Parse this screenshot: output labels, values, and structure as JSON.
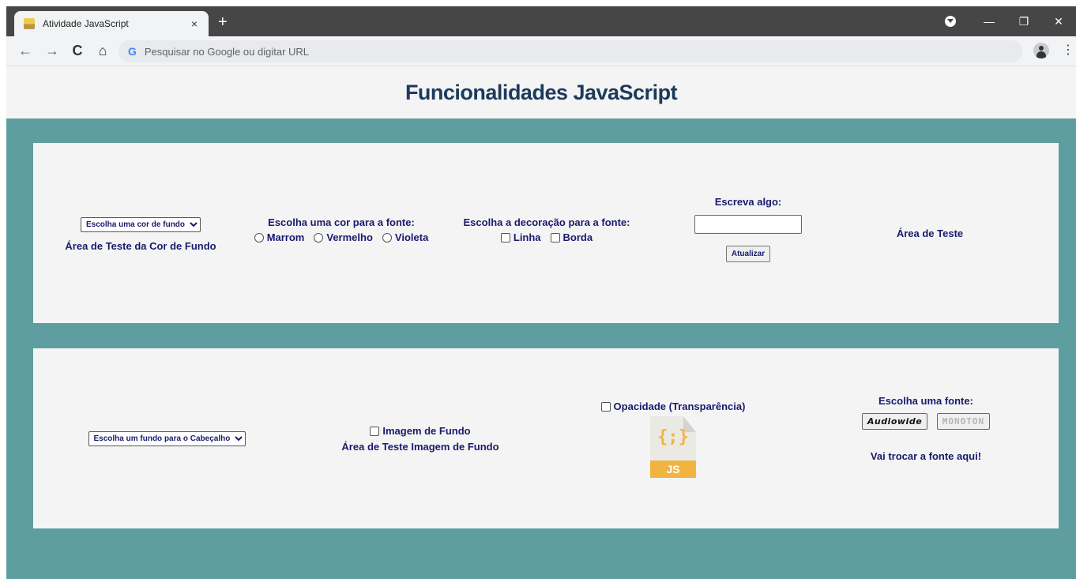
{
  "browser": {
    "tab_title": "Atividade JavaScript",
    "tab_close": "×",
    "new_tab": "+",
    "omnibox_placeholder": "Pesquisar no Google ou digitar URL",
    "google_letter": "G",
    "back_icon": "←",
    "forward_icon": "→",
    "reload_icon": "C",
    "home_icon": "⌂",
    "menu_icon": "⋮",
    "minimize_icon": "—",
    "restore_icon": "❐",
    "close_icon": "✕"
  },
  "header": {
    "title": "Funcionalidades JavaScript"
  },
  "panel1": {
    "bg_select": "Escolha uma cor de fundo",
    "bg_area_label": "Área de Teste da Cor de Fundo",
    "font_color_label": "Escolha uma cor para a fonte:",
    "font_colors": [
      "Marrom",
      "Vermelho",
      "Violeta"
    ],
    "decoration_label": "Escolha a decoração para a fonte:",
    "decorations": [
      "Linha",
      "Borda"
    ],
    "write_label": "Escreva algo:",
    "update_button": "Atualizar",
    "test_area": "Área de Teste"
  },
  "panel2": {
    "header_bg_select": "Escolha um fundo para o Cabeçalho",
    "bg_image_checkbox": "Imagem de Fundo",
    "bg_image_area": "Área de Teste Imagem de Fundo",
    "opacity_checkbox": "Opacidade (Transparência)",
    "js_icon_braces": "{;}",
    "js_icon_label": "JS",
    "font_choose_label": "Escolha uma fonte:",
    "font_options": [
      "Audiowide",
      "MONOTON"
    ],
    "font_swap_text": "Vai trocar a fonte aqui!"
  },
  "colors": {
    "page_bg": "#5f9ea0",
    "panel_bg": "#f4f4f4",
    "title": "#1c3a5c",
    "text": "#1a1a6e",
    "js_accent": "#f2b441"
  }
}
